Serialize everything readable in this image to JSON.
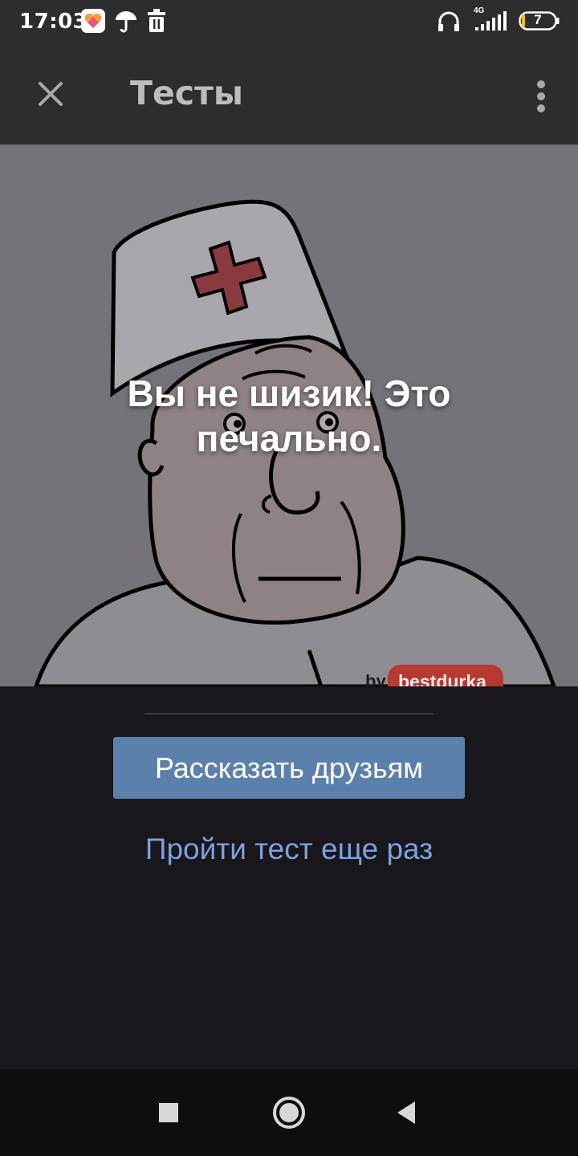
{
  "status_bar": {
    "time": "17:03",
    "network": "4G",
    "battery": "7",
    "left_icons": [
      "app-heart-icon",
      "umbrella-icon",
      "trash-icon"
    ],
    "right_icons": [
      "headphones-icon",
      "signal-icon",
      "battery-icon"
    ]
  },
  "app_bar": {
    "title": "Тесты",
    "close_icon": "close-icon",
    "menu_icon": "more-vertical-icon"
  },
  "result": {
    "text": "Вы не шизик! Это печально.",
    "watermark_by": "by",
    "watermark_brand": "bestdurka"
  },
  "actions": {
    "share_label": "Рассказать друзьям",
    "retry_label": "Пройти тест еще раз"
  },
  "nav_bar": {
    "icons": [
      "recents-square-icon",
      "home-circle-icon",
      "back-triangle-icon"
    ]
  },
  "colors": {
    "bar_bg": "#2d2d30",
    "panel_bg": "#19171c",
    "button_bg": "#5c80ac",
    "link": "#7aa2dd",
    "cross_red": "#c0392b"
  }
}
